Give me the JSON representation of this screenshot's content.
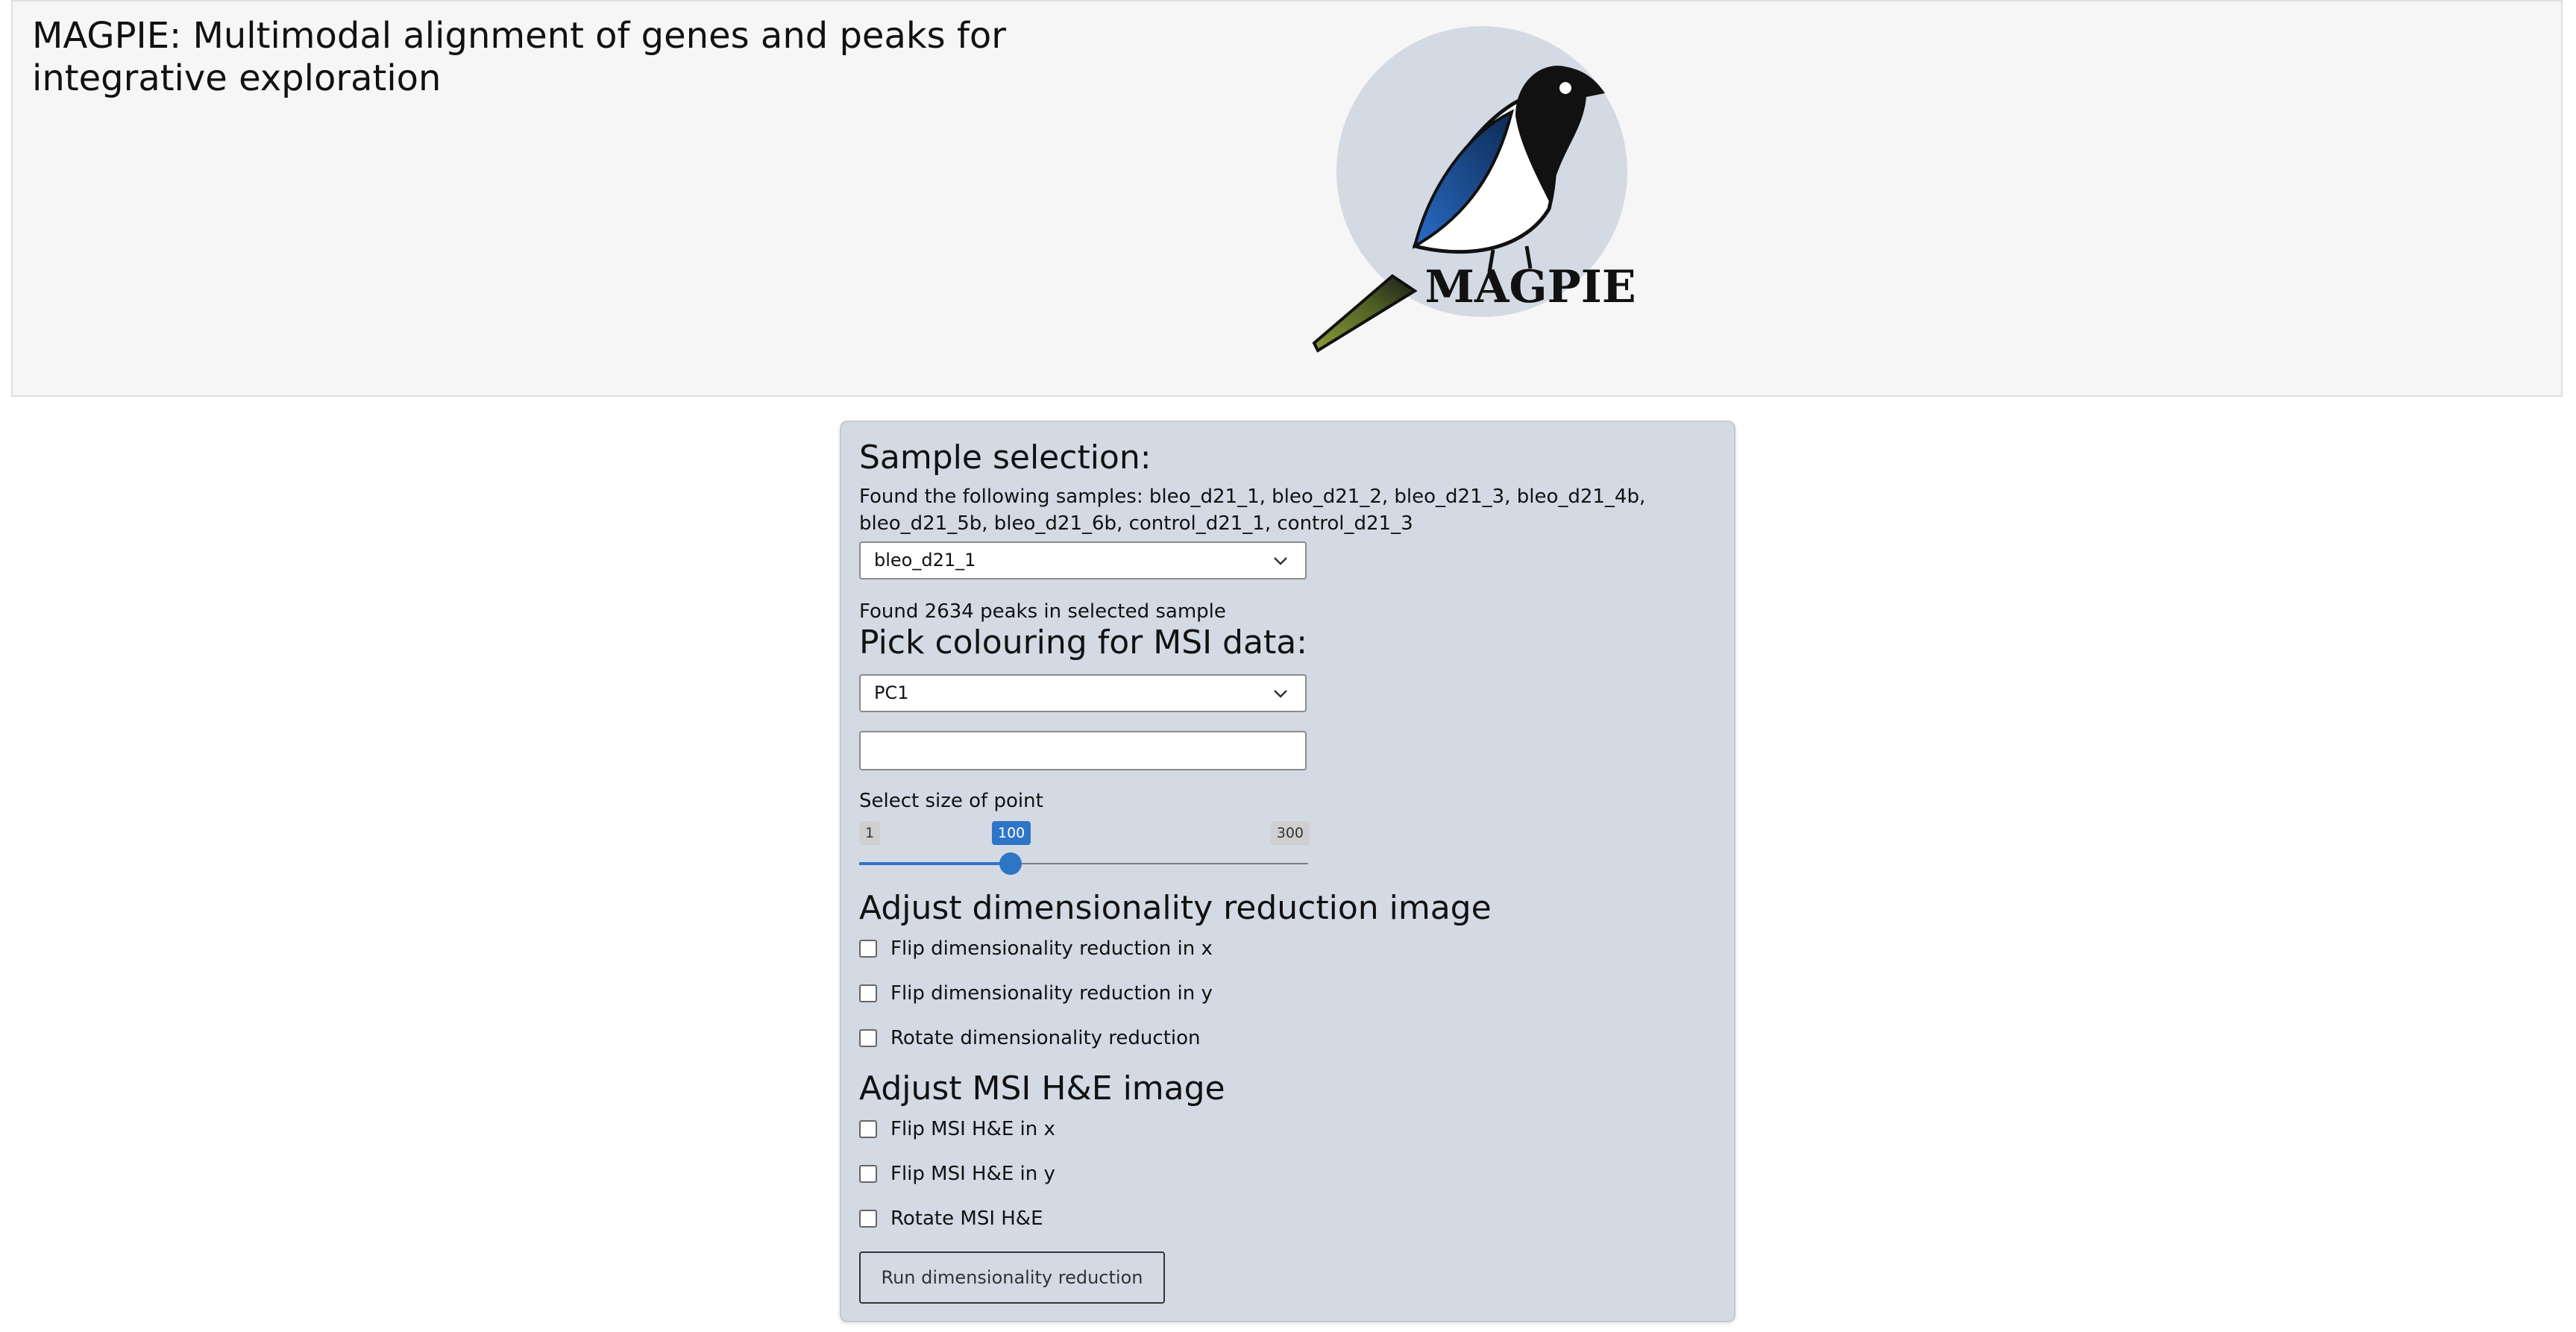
{
  "header": {
    "title": "MAGPIE: Multimodal alignment of genes and peaks for integrative exploration",
    "logo_text": "MAGPIE"
  },
  "sample_selection": {
    "heading": "Sample selection:",
    "found_text": "Found the following samples: bleo_d21_1, bleo_d21_2, bleo_d21_3, bleo_d21_4b, bleo_d21_5b, bleo_d21_6b, control_d21_1, control_d21_3",
    "selected_sample": "bleo_d21_1",
    "peaks_text": "Found 2634 peaks in selected sample"
  },
  "colouring": {
    "heading": "Pick colouring for MSI data:",
    "selected": "PC1",
    "text_value": ""
  },
  "point_size": {
    "label": "Select size of point",
    "min": "1",
    "max": "300",
    "value": "100",
    "fraction": 0.3311
  },
  "dimred": {
    "heading": "Adjust dimensionality reduction image",
    "options": [
      {
        "label": "Flip dimensionality reduction in x",
        "checked": false
      },
      {
        "label": "Flip dimensionality reduction in y",
        "checked": false
      },
      {
        "label": "Rotate dimensionality reduction",
        "checked": false
      }
    ]
  },
  "msi": {
    "heading": "Adjust MSI H&E image",
    "options": [
      {
        "label": "Flip MSI H&E in x",
        "checked": false
      },
      {
        "label": "Flip MSI H&E in y",
        "checked": false
      },
      {
        "label": "Rotate MSI H&E",
        "checked": false
      }
    ]
  },
  "run_button": "Run dimensionality reduction",
  "icons": {
    "dropdown": "chevron-down-icon",
    "logo": "magpie-logo"
  },
  "colors": {
    "accent": "#2e75c6",
    "panel": "#d3dae3",
    "header_bg": "#f6f6f6",
    "bird_green": "#6e8a2e",
    "bird_blue": "#2e6fc0"
  }
}
